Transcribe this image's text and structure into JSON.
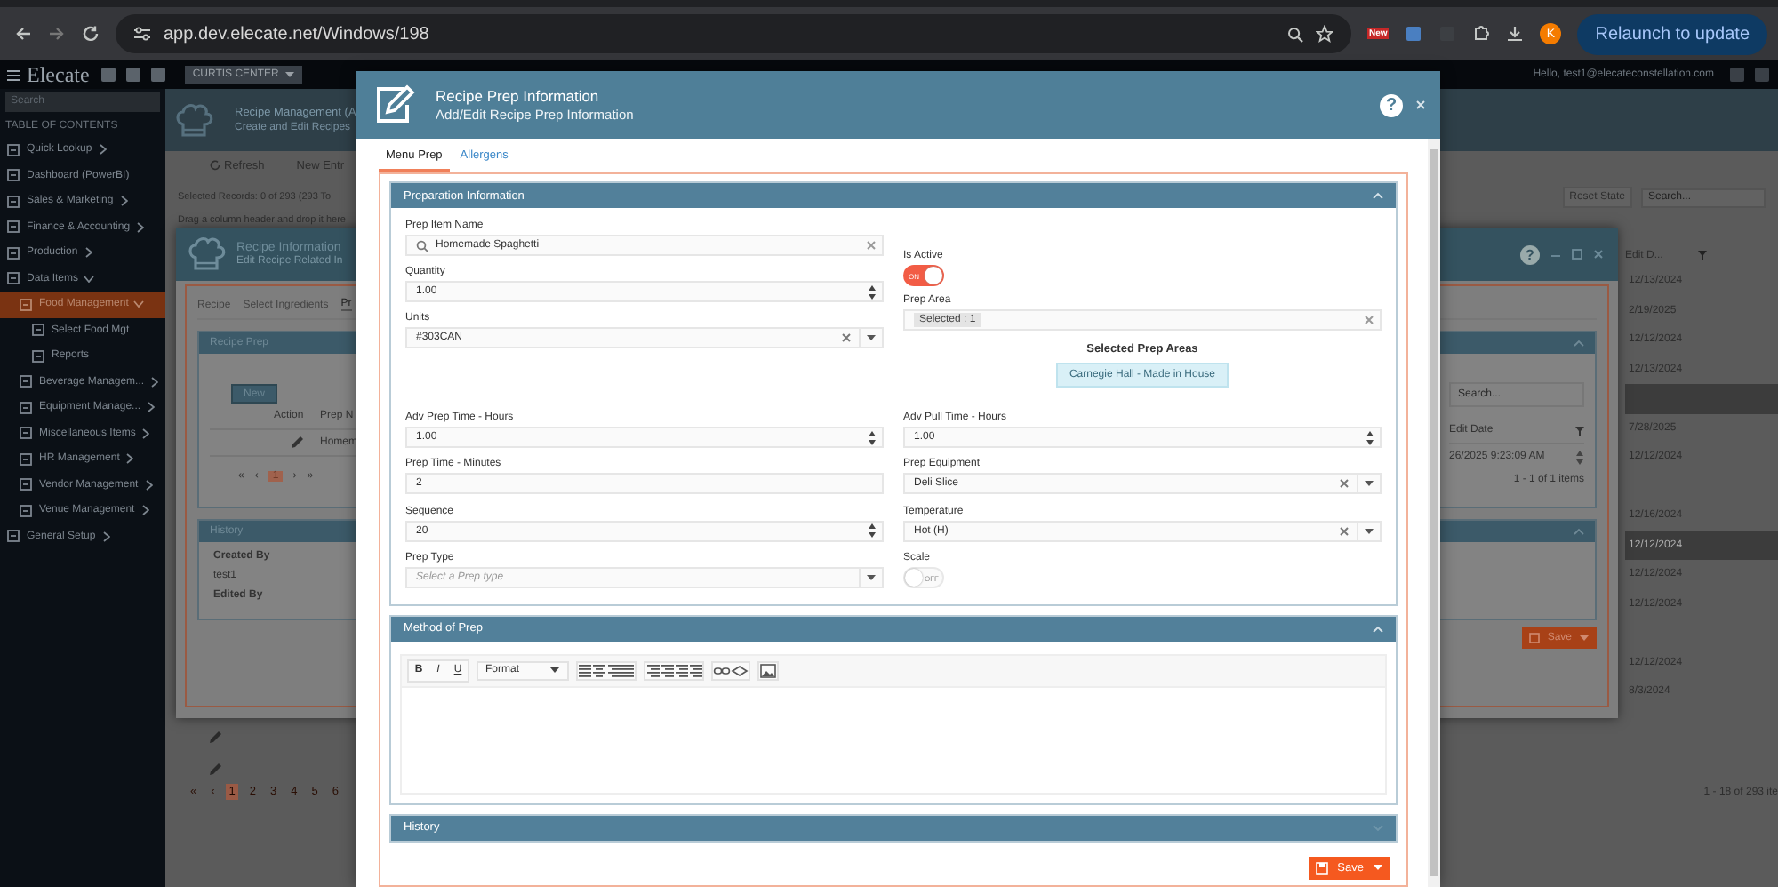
{
  "browser": {
    "url": "app.dev.elecate.net/Windows/198",
    "badge": "New",
    "profile_initial": "K",
    "update_button": "Relaunch to update"
  },
  "app_bar": {
    "logo": "Elecate",
    "location": "CURTIS CENTER",
    "greeting": "Hello, test1@elecateconstellation.com"
  },
  "sidebar": {
    "search_placeholder": "Search",
    "heading": "TABLE OF CONTENTS",
    "items": [
      {
        "label": "Quick Lookup",
        "selected": false,
        "expanded": false
      },
      {
        "label": "Dashboard (PowerBI)",
        "selected": false
      },
      {
        "label": "Sales & Marketing",
        "selected": false,
        "expanded": false
      },
      {
        "label": "Finance & Accounting",
        "selected": false,
        "expanded": false
      },
      {
        "label": "Production",
        "selected": false,
        "expanded": false
      },
      {
        "label": "Data Items",
        "selected": false,
        "expanded": true,
        "children": [
          {
            "label": "Food Management",
            "selected": true,
            "expanded": true,
            "children": [
              {
                "label": "Select Food Mgt",
                "selected": false
              },
              {
                "label": "Reports",
                "selected": false
              }
            ]
          },
          {
            "label": "Beverage Managem...",
            "selected": false,
            "expanded": false
          },
          {
            "label": "Equipment Manage...",
            "selected": false,
            "expanded": false
          },
          {
            "label": "Miscellaneous Items",
            "selected": false,
            "expanded": false
          },
          {
            "label": "HR Management",
            "selected": false,
            "expanded": false
          },
          {
            "label": "Vendor Management",
            "selected": false,
            "expanded": false
          },
          {
            "label": "Venue Management",
            "selected": false,
            "expanded": false
          }
        ]
      },
      {
        "label": "General Setup",
        "selected": false,
        "expanded": false
      }
    ]
  },
  "page": {
    "title": "Recipe Management (A",
    "subtitle": "Create and Edit Recipes",
    "refresh_button": "Refresh",
    "new_button": "New Entr",
    "selected_records": "Selected Records: 0 of 293 (293 To",
    "group_hint": "Drag a column header and drop it here",
    "reset_button": "Reset State",
    "search_placeholder": "Search...",
    "date_column": "Edit D...",
    "rows": [
      {
        "date": "12/13/2024",
        "selected": false
      },
      {
        "date": "2/19/2025",
        "selected": false
      },
      {
        "date": "12/12/2024",
        "selected": false
      },
      {
        "date": "12/13/2024",
        "selected": false
      },
      {
        "selected": true
      },
      {
        "date": "7/28/2025",
        "selected": false
      },
      {
        "date": "12/12/2024",
        "selected": false
      },
      {
        "selected": false
      },
      {
        "date": "12/16/2024",
        "selected": false
      },
      {
        "date": "12/12/2024",
        "selected": true
      },
      {
        "date": "12/12/2024",
        "selected": false
      },
      {
        "date": "12/12/2024",
        "selected": false
      },
      {
        "selected": false
      },
      {
        "date": "12/12/2024",
        "selected": false
      },
      {
        "date": "8/3/2024",
        "selected": false
      }
    ],
    "pager_first": "«",
    "pager_prev": "‹",
    "pages": [
      {
        "label": "1",
        "selected": true
      },
      {
        "label": "2",
        "selected": false
      },
      {
        "label": "3",
        "selected": false
      },
      {
        "label": "4",
        "selected": false
      },
      {
        "label": "5",
        "selected": false
      },
      {
        "label": "6",
        "selected": false
      }
    ],
    "pager_info": "1 - 18 of 293 ite"
  },
  "recipe_window": {
    "title": "Recipe Information",
    "subtitle": "Edit Recipe Related In",
    "help": "?",
    "tabs": [
      {
        "label": "Recipe",
        "selected": false
      },
      {
        "label": "Select Ingredients",
        "selected": false
      },
      {
        "label": "Pr",
        "selected": true
      }
    ],
    "prep_panel": {
      "title": "Recipe Prep",
      "new_button": "New",
      "columns": [
        "Action",
        "Prep N"
      ],
      "row_name": "Homem",
      "pager_first": "«",
      "pager_prev": "‹",
      "pages": [
        {
          "label": "1",
          "selected": true
        }
      ],
      "pager_next": "›",
      "pager_last": "»",
      "search_placeholder": "Search...",
      "date_column": "Edit Date",
      "row_date": "26/2025 9:23:09 AM",
      "pager_info": "1 - 1 of 1 items"
    },
    "history": {
      "title": "History",
      "created_label": "Created By",
      "created_value": "test1",
      "edited_label": "Edited By"
    },
    "save_button": "Save"
  },
  "prep_window": {
    "title": "Recipe Prep Information",
    "subtitle": "Add/Edit Recipe Prep Information",
    "help": "?",
    "tabs": [
      {
        "label": "Menu Prep",
        "selected": true
      },
      {
        "label": "Allergens",
        "selected": false
      }
    ],
    "preparation": {
      "title": "Preparation Information",
      "expanded": true,
      "left_fields": [
        {
          "label": "Prep Item Name",
          "kind": "search",
          "value": "Homemade Spaghetti"
        },
        {
          "label": "Quantity",
          "kind": "number",
          "value": "1.00"
        },
        {
          "label": "Units",
          "kind": "select",
          "value": "#303CAN"
        }
      ],
      "is_active": {
        "label": "Is Active",
        "on": true,
        "text": "ON"
      },
      "prep_area": {
        "label": "Prep Area",
        "chip": "Selected : 1"
      },
      "selected_areas": {
        "title": "Selected Prep Areas",
        "items": [
          "Carnegie Hall - Made in House"
        ]
      },
      "fields": [
        {
          "label": "Adv Prep Time - Hours",
          "kind": "number",
          "value": "1.00"
        },
        {
          "label": "Adv Pull Time - Hours",
          "kind": "number",
          "value": "1.00"
        },
        {
          "label": "Prep Time - Minutes",
          "kind": "text",
          "value": "2"
        },
        {
          "label": "Prep Equipment",
          "kind": "select",
          "value": "Deli Slice"
        },
        {
          "label": "Sequence",
          "kind": "number",
          "value": "20"
        },
        {
          "label": "Temperature",
          "kind": "select",
          "value": "Hot (H)"
        },
        {
          "label": "Prep Type",
          "kind": "select",
          "placeholder": "Select a Prep type"
        },
        {
          "label": "Scale",
          "kind": "toggle",
          "on": false,
          "text": "OFF"
        }
      ]
    },
    "method": {
      "title": "Method of Prep",
      "expanded": true,
      "format_buttons": [
        "B",
        "I",
        "U"
      ],
      "format_dropdown": "Format"
    },
    "history": {
      "title": "History",
      "expanded": false
    },
    "save_button": "Save"
  }
}
